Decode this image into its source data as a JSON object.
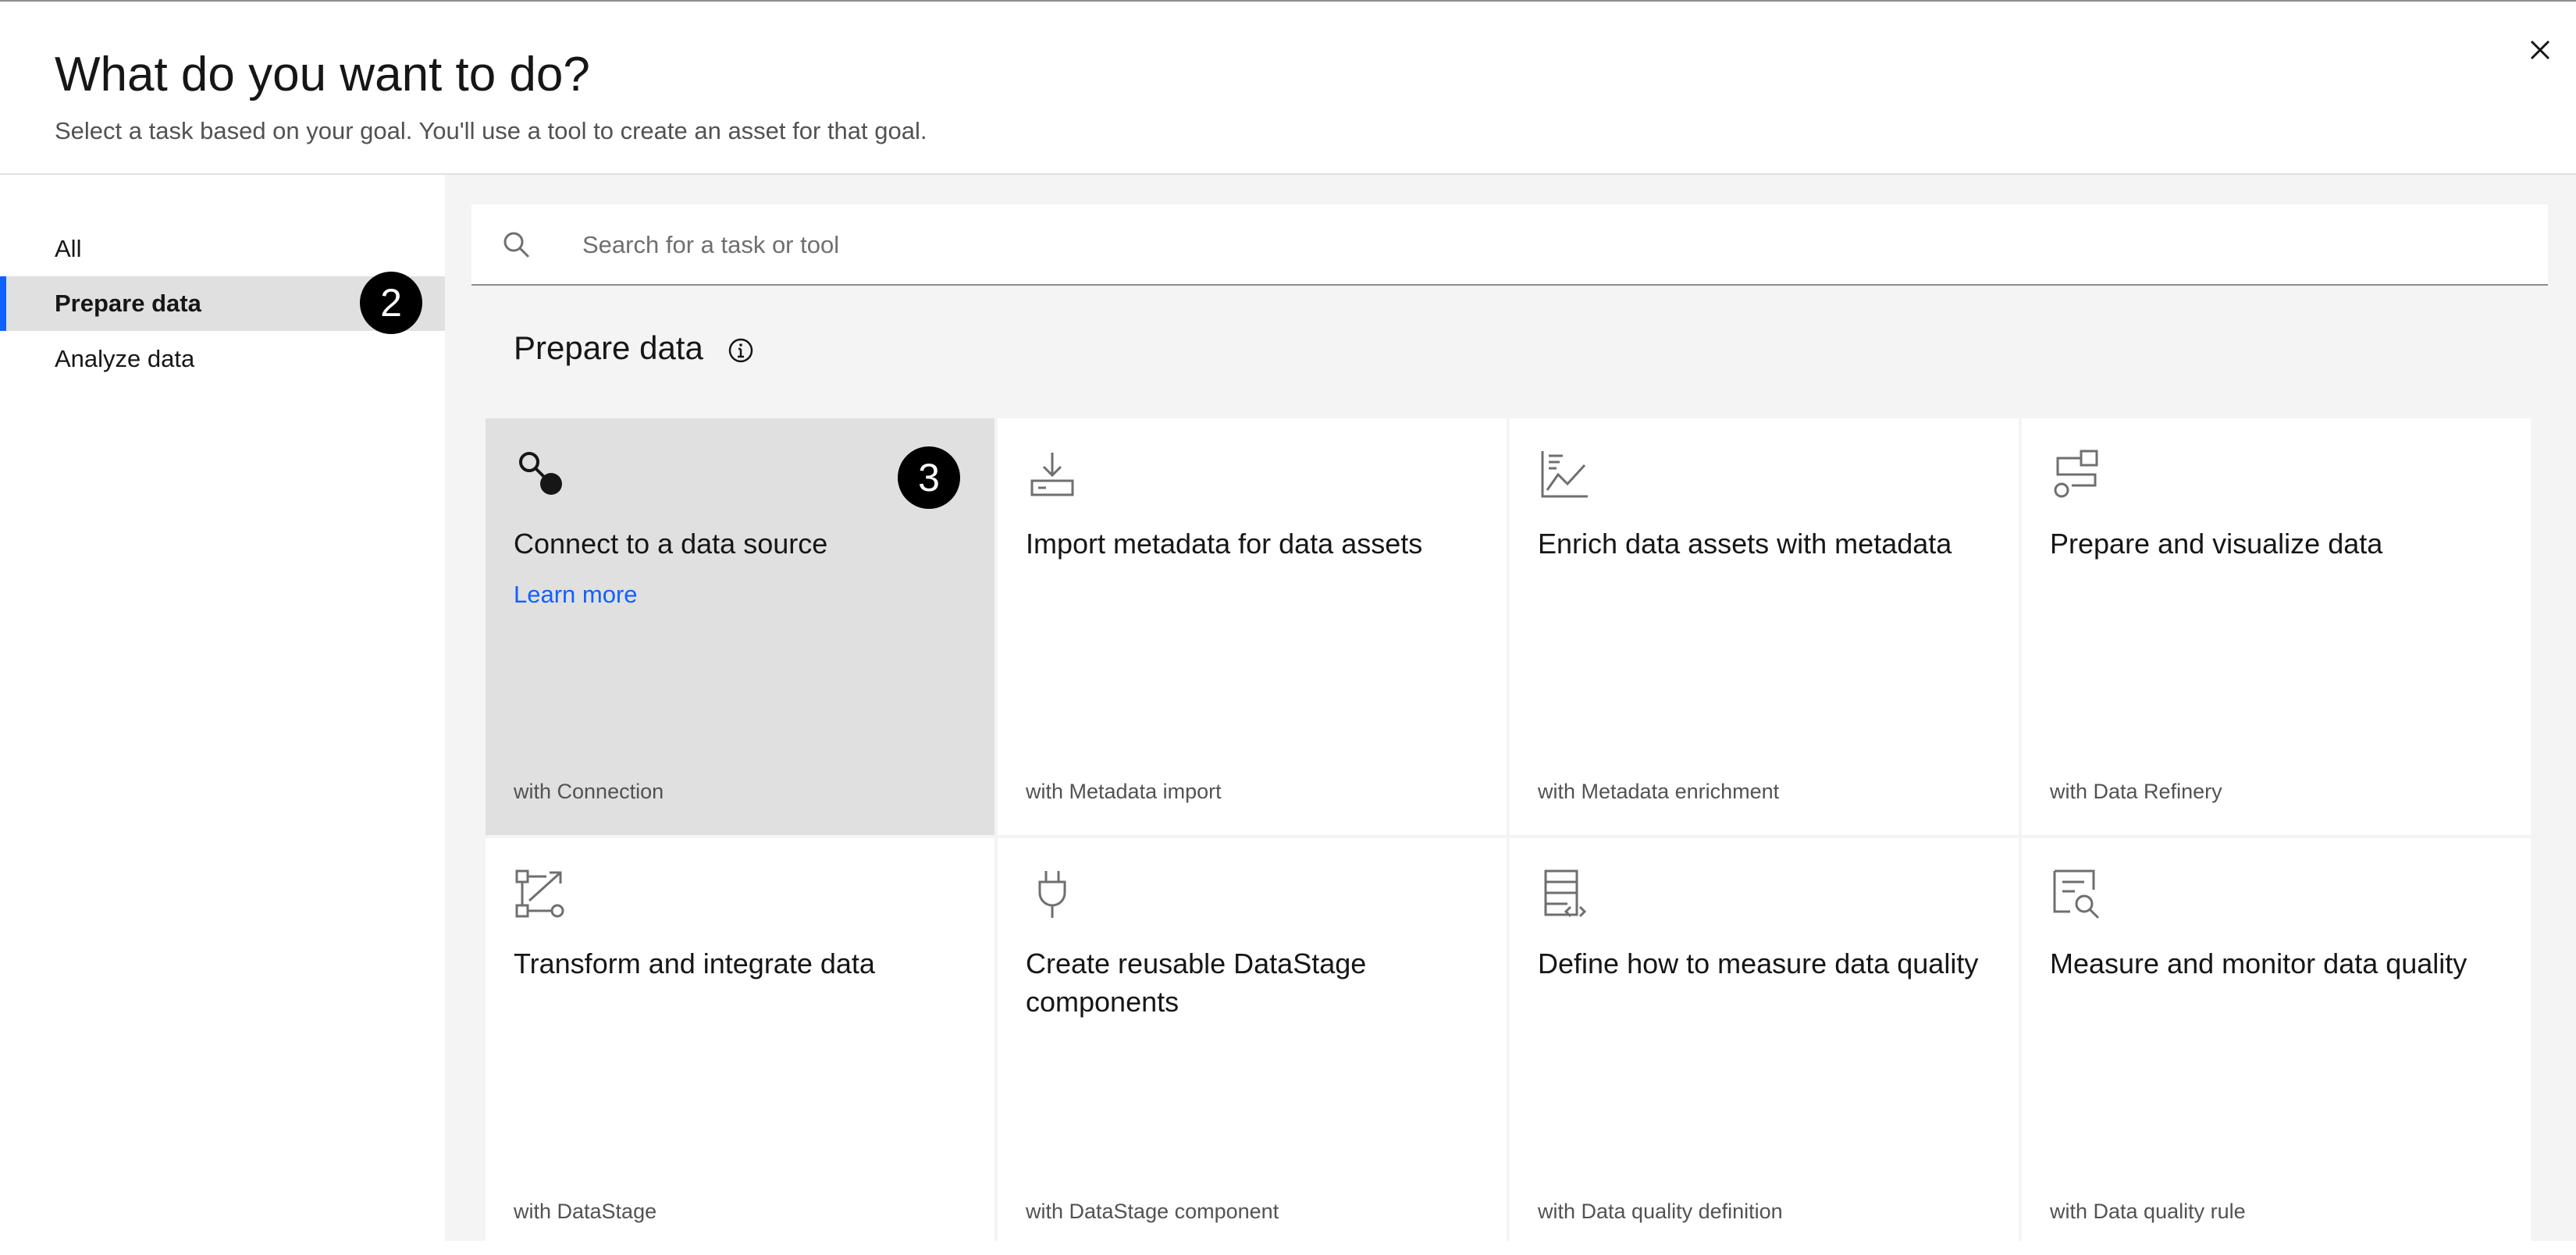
{
  "header": {
    "title": "What do you want to do?",
    "subtitle": "Select a task based on your goal. You'll use a tool to create an asset for that goal."
  },
  "sidebar": {
    "items": [
      {
        "label": "All"
      },
      {
        "label": "Prepare data"
      },
      {
        "label": "Analyze data"
      }
    ],
    "selected": "Prepare data"
  },
  "search": {
    "placeholder": "Search for a task or tool"
  },
  "section": {
    "title": "Prepare data"
  },
  "annotations": {
    "badge_sidebar": "2",
    "badge_card": "3"
  },
  "cards": [
    {
      "title": "Connect to a data source",
      "link": "Learn more",
      "tool": "with Connection",
      "icon": "connection-icon",
      "selected": true
    },
    {
      "title": "Import metadata for data assets",
      "tool": "with Metadata import",
      "icon": "download-icon"
    },
    {
      "title": "Enrich data assets with metadata",
      "tool": "with Metadata enrichment",
      "icon": "chart-line-icon"
    },
    {
      "title": "Prepare and visualize data",
      "tool": "with Data Refinery",
      "icon": "data-refinery-icon"
    },
    {
      "title": "Transform and integrate data",
      "tool": "with DataStage",
      "icon": "transform-icon"
    },
    {
      "title": "Create reusable DataStage components",
      "tool": "with DataStage component",
      "icon": "plug-icon"
    },
    {
      "title": "Define how to measure data quality",
      "tool": "with Data quality definition",
      "icon": "data-definition-icon"
    },
    {
      "title": "Measure and monitor data quality",
      "tool": "with Data quality rule",
      "icon": "data-quality-rule-icon"
    }
  ],
  "colors": {
    "accent": "#0f62fe",
    "selected_bg": "#e0e0e0",
    "main_bg": "#f4f4f4",
    "badge_bg": "#000000"
  }
}
